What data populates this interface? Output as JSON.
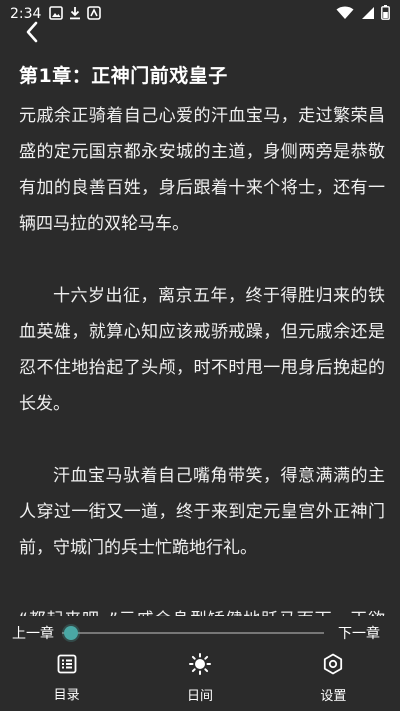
{
  "status_bar": {
    "time": "2:34",
    "left_icons": [
      "image-icon",
      "download-icon",
      "app-icon"
    ],
    "right_icons": [
      "wifi-icon",
      "signal-icon",
      "battery-icon"
    ]
  },
  "header": {
    "back_icon": "chevron-left-icon"
  },
  "chapter": {
    "title": "第1章：正神门前戏皇子",
    "paragraphs": [
      "元戚余正骑着自己心爱的汗血宝马，走过繁荣昌盛的定元国京都永安城的主道，身侧两旁是恭敬有加的良善百姓，身后跟着十来个将士，还有一辆四马拉的双轮马车。",
      "十六岁出征，离京五年，终于得胜归来的铁血英雄，就算心知应该戒骄戒躁，但元戚余还是忍不住地抬起了头颅，时不时甩一甩身后挽起的长发。",
      "汗血宝马驮着自己嘴角带笑，得意满满的主人穿过一街又一道，终于来到定元皇宫外正神门前，守城门的兵士忙跪地行礼。",
      "“都起来吧。”元戚余身型矫健地跃马而下，正欲昂首挺胸地走进城门去，却眼神一瞥，嘴角的笑"
    ]
  },
  "progress": {
    "prev_label": "上一章",
    "next_label": "下一章",
    "value": 0.01
  },
  "bottom_nav": {
    "items": [
      {
        "label": "目录",
        "icon": "catalog-icon"
      },
      {
        "label": "日间",
        "icon": "sun-icon"
      },
      {
        "label": "设置",
        "icon": "gear-icon"
      }
    ]
  },
  "colors": {
    "background": "#2b2b2b",
    "text": "#ffffff",
    "accent": "#4aa8a5",
    "track": "#777777"
  }
}
